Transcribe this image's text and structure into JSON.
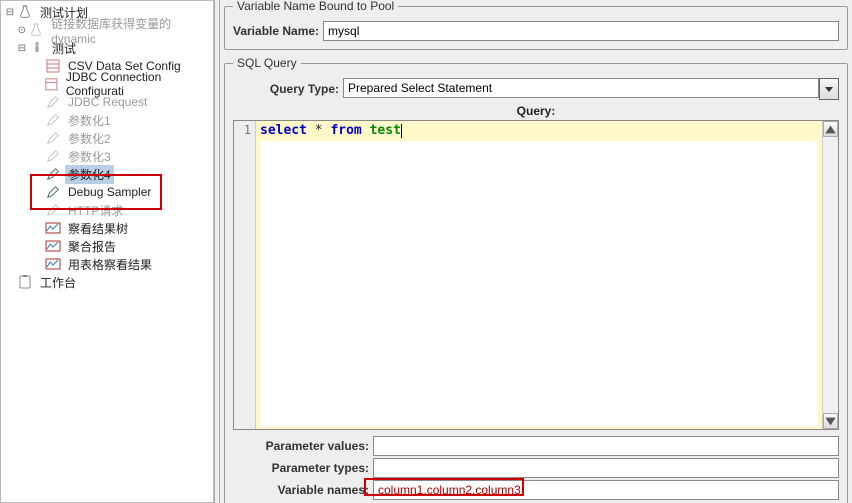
{
  "tree": {
    "root": "测试计划",
    "dynamic": "链接数据库获得变量的dynamic",
    "test": "测试",
    "csv": "CSV Data Set Config",
    "jdbcConn": "JDBC Connection Configurati",
    "jdbcReq": "JDBC Request",
    "param1": "参数化1",
    "param2": "参数化2",
    "param3": "参数化3",
    "param4": "参数化4",
    "debug": "Debug Sampler",
    "http": "HTTP请求",
    "viewTree": "察看结果树",
    "agg": "聚合报告",
    "tableView": "用表格察看结果",
    "workbench": "工作台"
  },
  "panel": {
    "varBound": {
      "legend": "Variable Name Bound to Pool",
      "label": "Variable Name:",
      "value": "mysql"
    },
    "sqlQuery": {
      "legend": "SQL Query",
      "queryTypeLabel": "Query Type:",
      "queryTypeValue": "Prepared Select Statement",
      "queryHeader": "Query:",
      "lineNumber": "1",
      "sql_select": "select",
      "sql_star": "*",
      "sql_from": "from",
      "sql_table": "test"
    },
    "bottom": {
      "paramValuesLabel": "Parameter values:",
      "paramValuesValue": "",
      "paramTypesLabel": "Parameter types:",
      "paramTypesValue": "",
      "varNamesLabel": "Variable names:",
      "varNamesValue": "column1,column2,column3"
    }
  },
  "icons": {
    "flask": "flask-icon",
    "pencil": "pencil-icon",
    "tube": "tube-icon",
    "file": "file-icon",
    "box": "box-icon",
    "gear": "gear-icon",
    "clipboard": "clipboard-icon"
  }
}
